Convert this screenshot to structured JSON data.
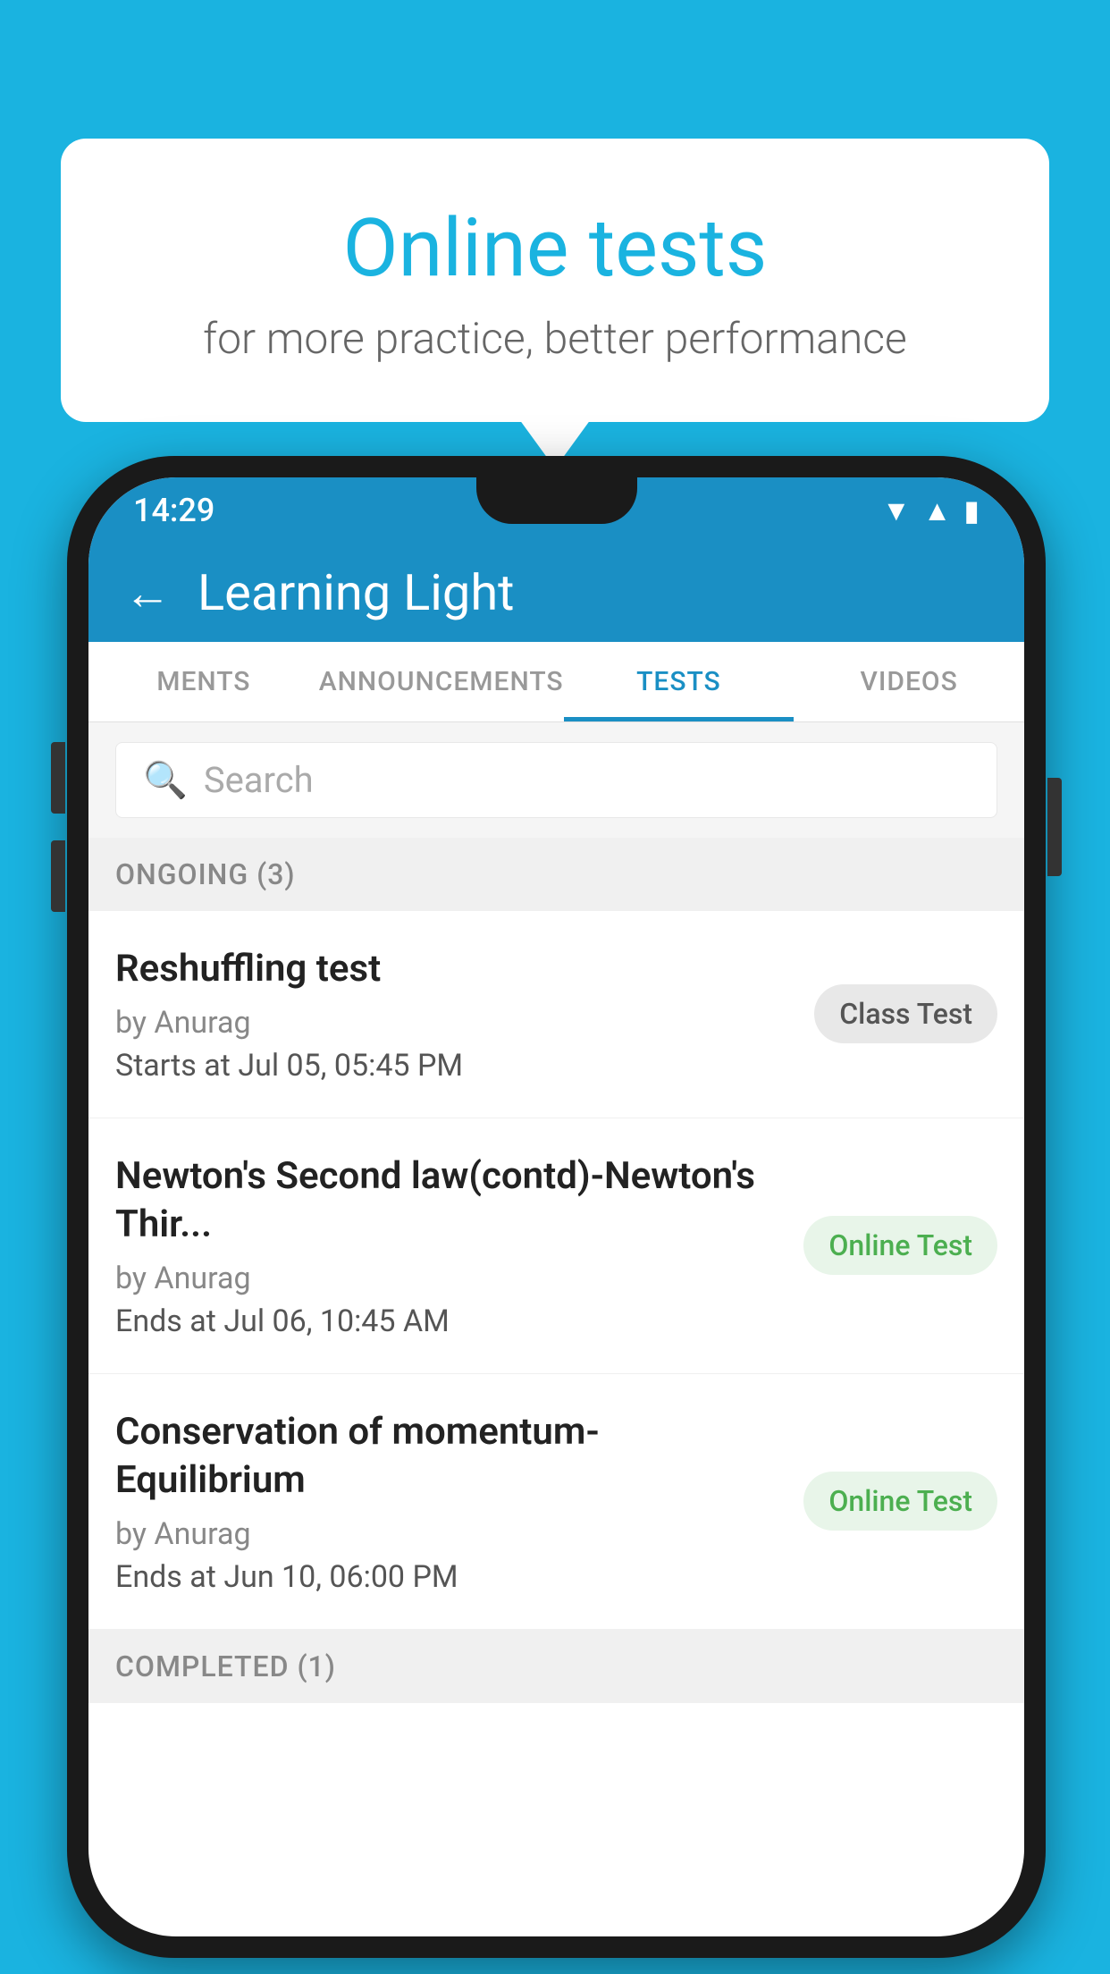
{
  "background_color": "#1ab3e0",
  "promo": {
    "title": "Online tests",
    "subtitle": "for more practice, better performance"
  },
  "phone": {
    "status_bar": {
      "time": "14:29"
    },
    "app_bar": {
      "back_label": "←",
      "title": "Learning Light"
    },
    "tabs": [
      {
        "label": "MENTS",
        "active": false
      },
      {
        "label": "ANNOUNCEMENTS",
        "active": false
      },
      {
        "label": "TESTS",
        "active": true
      },
      {
        "label": "VIDEOS",
        "active": false
      }
    ],
    "search": {
      "placeholder": "Search"
    },
    "ongoing_section": {
      "label": "ONGOING (3)"
    },
    "tests": [
      {
        "name": "Reshuffling test",
        "by": "by Anurag",
        "time_label": "Starts at",
        "time": "Jul 05, 05:45 PM",
        "badge": "Class Test",
        "badge_type": "class"
      },
      {
        "name": "Newton's Second law(contd)-Newton's Thir...",
        "by": "by Anurag",
        "time_label": "Ends at",
        "time": "Jul 06, 10:45 AM",
        "badge": "Online Test",
        "badge_type": "online"
      },
      {
        "name": "Conservation of momentum-Equilibrium",
        "by": "by Anurag",
        "time_label": "Ends at",
        "time": "Jun 10, 06:00 PM",
        "badge": "Online Test",
        "badge_type": "online"
      }
    ],
    "completed_section": {
      "label": "COMPLETED (1)"
    }
  }
}
